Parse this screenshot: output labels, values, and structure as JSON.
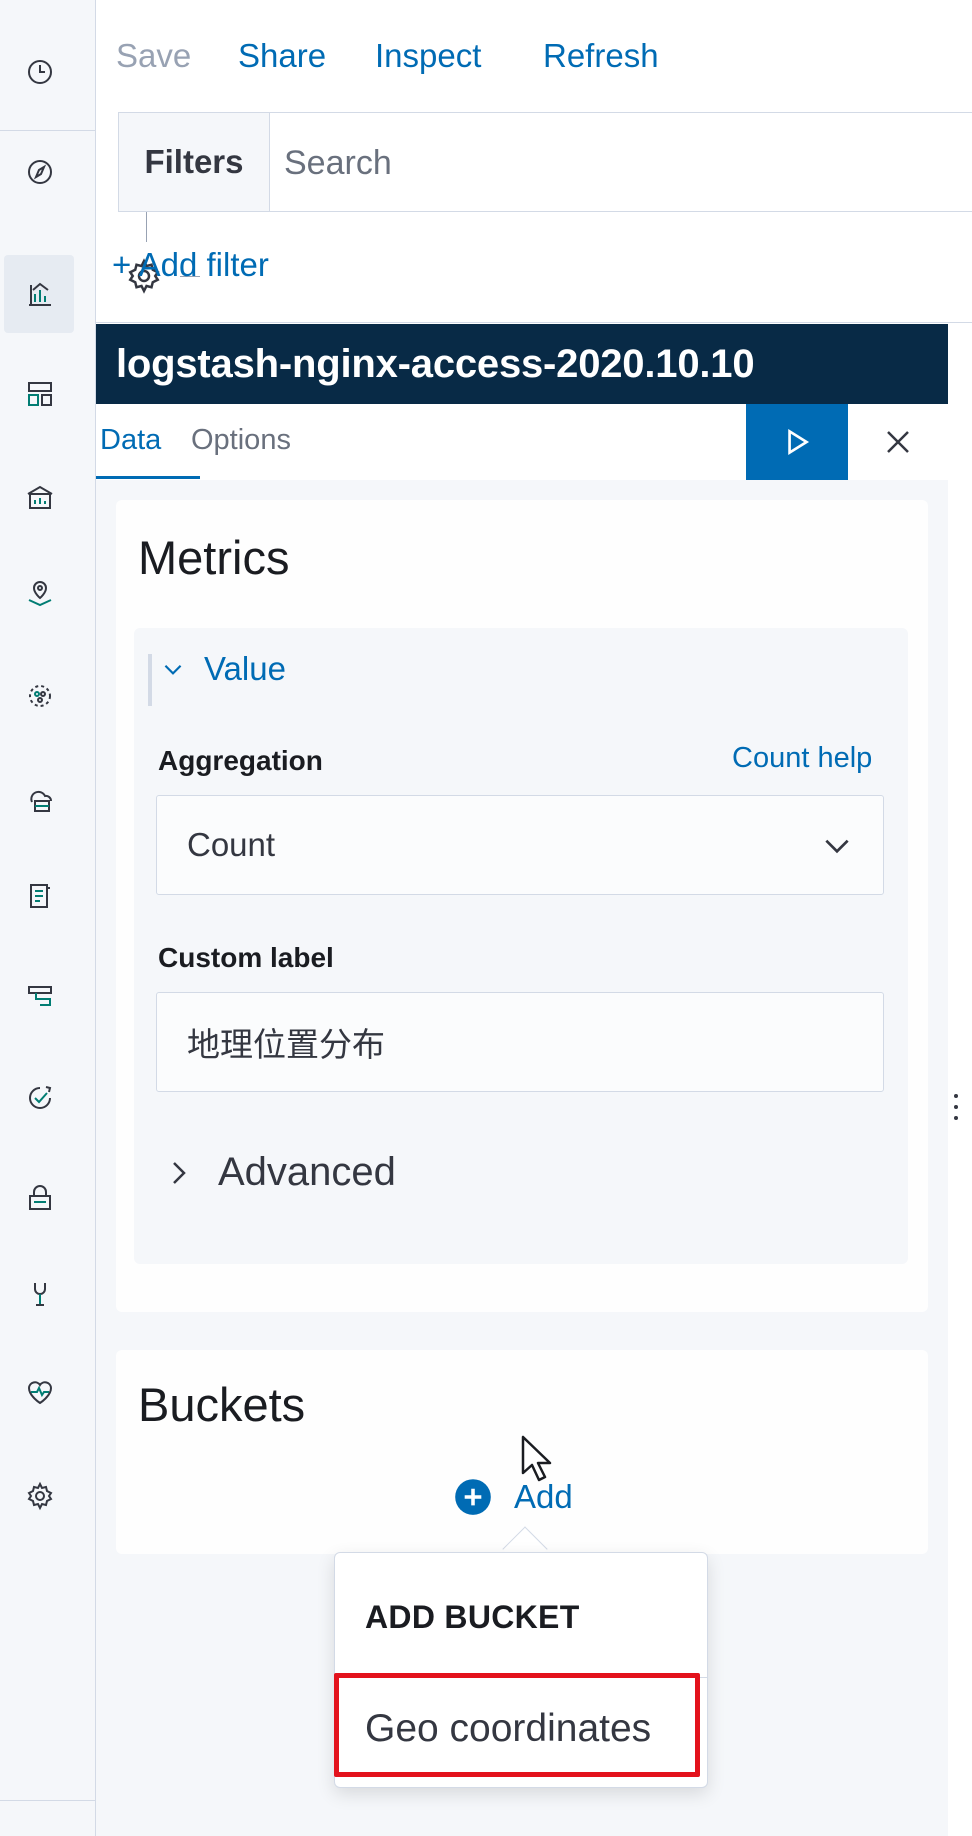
{
  "toolbar": {
    "save_label": "Save",
    "share_label": "Share",
    "inspect_label": "Inspect",
    "refresh_label": "Refresh"
  },
  "query_bar": {
    "filters_label": "Filters",
    "search_placeholder": "Search",
    "add_filter_label": "+ Add filter"
  },
  "nav": {
    "icons": [
      "recently-viewed-clock-icon",
      "discover-compass-icon",
      "visualize-icon",
      "dashboard-icon",
      "canvas-icon",
      "maps-icon",
      "machine-learning-icon",
      "infrastructure-icon",
      "logs-icon",
      "apm-icon",
      "uptime-icon",
      "siem-icon",
      "dev-tools-icon",
      "stack-monitoring-icon",
      "management-gear-icon"
    ]
  },
  "editor": {
    "index_pattern": "logstash-nginx-access-2020.10.10",
    "tabs": [
      "Data",
      "Options"
    ],
    "selected_tab": "Data",
    "metrics": {
      "title": "Metrics",
      "value_label": "Value",
      "aggregation_label": "Aggregation",
      "help_link": "Count help",
      "aggregation_value": "Count",
      "custom_label_title": "Custom label",
      "custom_label_value": "地理位置分布",
      "advanced_label": "Advanced"
    },
    "buckets": {
      "title": "Buckets",
      "add_label": "Add"
    },
    "add_bucket_popover": {
      "title": "ADD BUCKET",
      "options": [
        "Geo coordinates"
      ]
    }
  },
  "colors": {
    "accent": "#006bb4",
    "header_bg": "#082a46",
    "highlight": "#e3121c",
    "panel_bg": "#f5f7fa"
  }
}
